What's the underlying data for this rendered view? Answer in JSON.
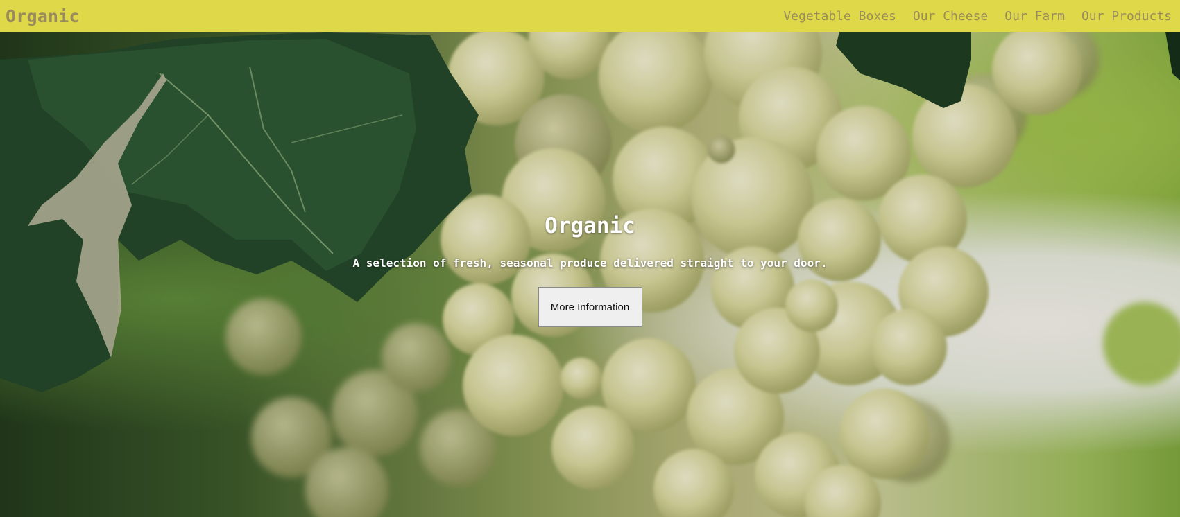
{
  "header": {
    "brand": "Organic",
    "nav": [
      {
        "label": "Vegetable Boxes"
      },
      {
        "label": "Our Cheese"
      },
      {
        "label": "Our Farm"
      },
      {
        "label": "Our Products"
      }
    ]
  },
  "hero": {
    "title": "Organic",
    "subtitle": "A selection of fresh, seasonal produce delivered straight to your door.",
    "button_label": "More Information",
    "image": "green-grapes-on-vine-photo"
  },
  "colors": {
    "header_bg": "#dfd94a",
    "header_text": "#9a8c5a",
    "hero_text": "#ffffff",
    "button_bg": "#efefef"
  }
}
